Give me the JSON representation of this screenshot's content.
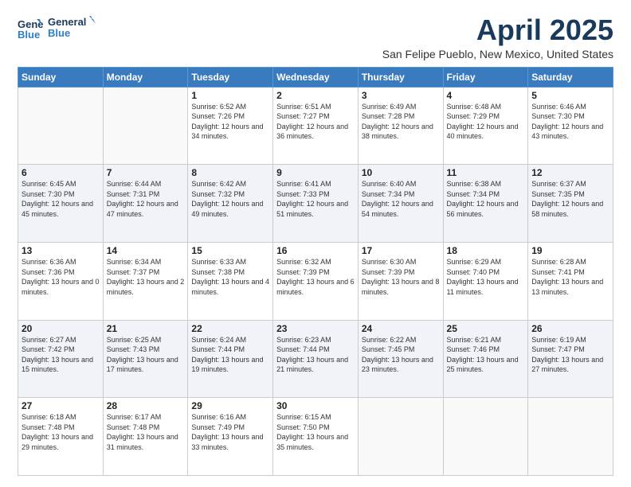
{
  "header": {
    "logo_line1": "General",
    "logo_line2": "Blue",
    "title": "April 2025",
    "subtitle": "San Felipe Pueblo, New Mexico, United States"
  },
  "calendar": {
    "days_of_week": [
      "Sunday",
      "Monday",
      "Tuesday",
      "Wednesday",
      "Thursday",
      "Friday",
      "Saturday"
    ],
    "weeks": [
      [
        {
          "day": "",
          "info": ""
        },
        {
          "day": "",
          "info": ""
        },
        {
          "day": "1",
          "info": "Sunrise: 6:52 AM\nSunset: 7:26 PM\nDaylight: 12 hours and 34 minutes."
        },
        {
          "day": "2",
          "info": "Sunrise: 6:51 AM\nSunset: 7:27 PM\nDaylight: 12 hours and 36 minutes."
        },
        {
          "day": "3",
          "info": "Sunrise: 6:49 AM\nSunset: 7:28 PM\nDaylight: 12 hours and 38 minutes."
        },
        {
          "day": "4",
          "info": "Sunrise: 6:48 AM\nSunset: 7:29 PM\nDaylight: 12 hours and 40 minutes."
        },
        {
          "day": "5",
          "info": "Sunrise: 6:46 AM\nSunset: 7:30 PM\nDaylight: 12 hours and 43 minutes."
        }
      ],
      [
        {
          "day": "6",
          "info": "Sunrise: 6:45 AM\nSunset: 7:30 PM\nDaylight: 12 hours and 45 minutes."
        },
        {
          "day": "7",
          "info": "Sunrise: 6:44 AM\nSunset: 7:31 PM\nDaylight: 12 hours and 47 minutes."
        },
        {
          "day": "8",
          "info": "Sunrise: 6:42 AM\nSunset: 7:32 PM\nDaylight: 12 hours and 49 minutes."
        },
        {
          "day": "9",
          "info": "Sunrise: 6:41 AM\nSunset: 7:33 PM\nDaylight: 12 hours and 51 minutes."
        },
        {
          "day": "10",
          "info": "Sunrise: 6:40 AM\nSunset: 7:34 PM\nDaylight: 12 hours and 54 minutes."
        },
        {
          "day": "11",
          "info": "Sunrise: 6:38 AM\nSunset: 7:34 PM\nDaylight: 12 hours and 56 minutes."
        },
        {
          "day": "12",
          "info": "Sunrise: 6:37 AM\nSunset: 7:35 PM\nDaylight: 12 hours and 58 minutes."
        }
      ],
      [
        {
          "day": "13",
          "info": "Sunrise: 6:36 AM\nSunset: 7:36 PM\nDaylight: 13 hours and 0 minutes."
        },
        {
          "day": "14",
          "info": "Sunrise: 6:34 AM\nSunset: 7:37 PM\nDaylight: 13 hours and 2 minutes."
        },
        {
          "day": "15",
          "info": "Sunrise: 6:33 AM\nSunset: 7:38 PM\nDaylight: 13 hours and 4 minutes."
        },
        {
          "day": "16",
          "info": "Sunrise: 6:32 AM\nSunset: 7:39 PM\nDaylight: 13 hours and 6 minutes."
        },
        {
          "day": "17",
          "info": "Sunrise: 6:30 AM\nSunset: 7:39 PM\nDaylight: 13 hours and 8 minutes."
        },
        {
          "day": "18",
          "info": "Sunrise: 6:29 AM\nSunset: 7:40 PM\nDaylight: 13 hours and 11 minutes."
        },
        {
          "day": "19",
          "info": "Sunrise: 6:28 AM\nSunset: 7:41 PM\nDaylight: 13 hours and 13 minutes."
        }
      ],
      [
        {
          "day": "20",
          "info": "Sunrise: 6:27 AM\nSunset: 7:42 PM\nDaylight: 13 hours and 15 minutes."
        },
        {
          "day": "21",
          "info": "Sunrise: 6:25 AM\nSunset: 7:43 PM\nDaylight: 13 hours and 17 minutes."
        },
        {
          "day": "22",
          "info": "Sunrise: 6:24 AM\nSunset: 7:44 PM\nDaylight: 13 hours and 19 minutes."
        },
        {
          "day": "23",
          "info": "Sunrise: 6:23 AM\nSunset: 7:44 PM\nDaylight: 13 hours and 21 minutes."
        },
        {
          "day": "24",
          "info": "Sunrise: 6:22 AM\nSunset: 7:45 PM\nDaylight: 13 hours and 23 minutes."
        },
        {
          "day": "25",
          "info": "Sunrise: 6:21 AM\nSunset: 7:46 PM\nDaylight: 13 hours and 25 minutes."
        },
        {
          "day": "26",
          "info": "Sunrise: 6:19 AM\nSunset: 7:47 PM\nDaylight: 13 hours and 27 minutes."
        }
      ],
      [
        {
          "day": "27",
          "info": "Sunrise: 6:18 AM\nSunset: 7:48 PM\nDaylight: 13 hours and 29 minutes."
        },
        {
          "day": "28",
          "info": "Sunrise: 6:17 AM\nSunset: 7:48 PM\nDaylight: 13 hours and 31 minutes."
        },
        {
          "day": "29",
          "info": "Sunrise: 6:16 AM\nSunset: 7:49 PM\nDaylight: 13 hours and 33 minutes."
        },
        {
          "day": "30",
          "info": "Sunrise: 6:15 AM\nSunset: 7:50 PM\nDaylight: 13 hours and 35 minutes."
        },
        {
          "day": "",
          "info": ""
        },
        {
          "day": "",
          "info": ""
        },
        {
          "day": "",
          "info": ""
        }
      ]
    ]
  }
}
